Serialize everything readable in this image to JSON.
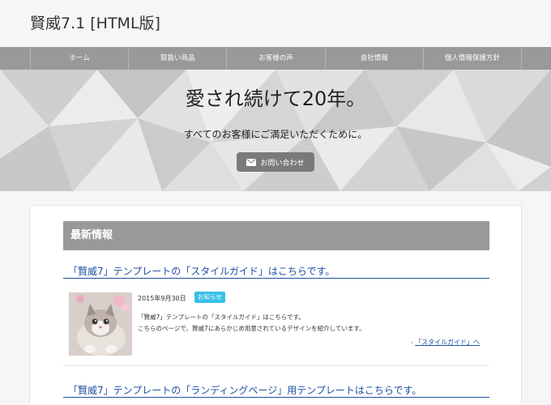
{
  "header": {
    "site_title": "賢威7.1 [HTML版]"
  },
  "nav": {
    "items": [
      {
        "label": "ホーム"
      },
      {
        "label": "取扱い商品"
      },
      {
        "label": "お客様の声"
      },
      {
        "label": "会社情報"
      },
      {
        "label": "個人情報保護方針"
      }
    ]
  },
  "hero": {
    "title": "愛され続けて20年。",
    "subtitle": "すべてのお客様にご満足いただくために。",
    "button_label": "お問い合わせ",
    "button_icon": "mail-icon"
  },
  "news": {
    "heading": "最新情報",
    "posts": [
      {
        "title": "「賢威7」テンプレートの「スタイルガイド」はこちらです。",
        "date": "2015年9月30日",
        "badge": "お知らせ",
        "excerpt_line1": "「賢威7」テンプレートの「スタイルガイド」はこちらです。",
        "excerpt_line2": "こちらのページで、賢威7にあらかじめ用意されているデザインを紹介しています。",
        "more_label": "「スタイルガイド」へ"
      },
      {
        "title": "「賢威7」テンプレートの「ランディングページ」用テンプレートはこちらです。"
      }
    ]
  },
  "colors": {
    "nav_bg": "#999999",
    "link": "#1e50a2",
    "badge": "#39c0e8",
    "button_bg": "#7a7a7a"
  }
}
